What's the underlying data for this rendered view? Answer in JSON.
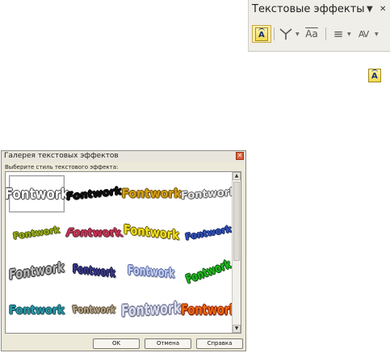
{
  "toolbar": {
    "title": "Текстовые эффекты",
    "menu_arrow": "▼",
    "close": "✕",
    "buttons": [
      "fontwork-gallery-icon",
      "fontwork-shape-icon",
      "same-letter-heights-icon",
      "alignment-icon",
      "character-spacing-icon"
    ],
    "same_heights_glyph": "Aa",
    "align_glyph": "≡",
    "spacing_glyph": "AV"
  },
  "standalone_icon": "fontwork-gallery-icon",
  "dialog": {
    "title": "Галерея текстовых эффектов",
    "close": "✕",
    "prompt": "Выберите стиль текстового эффекта:",
    "items": [
      {
        "text": "Fontwork",
        "color": "#ffffff",
        "stroke": "#444444"
      },
      {
        "text": "Fontwork",
        "color": "#111111",
        "stroke": "#000000"
      },
      {
        "text": "Fontwork",
        "color": "#d4a017",
        "stroke": "#6b4a00"
      },
      {
        "text": "Fontwork",
        "color": "#e8e8e8",
        "stroke": "#555555"
      },
      {
        "text": "Fontwork",
        "color": "#9cae1e",
        "stroke": "#4a5a00"
      },
      {
        "text": "Fontwork",
        "color": "#cc3355",
        "stroke": "#662233"
      },
      {
        "text": "Fontwork",
        "color": "#f2e21a",
        "stroke": "#6a5a00"
      },
      {
        "text": "Fontwork",
        "color": "#3355bb",
        "stroke": "#112266"
      },
      {
        "text": "Fontwork",
        "color": "#bbbbbb",
        "stroke": "#333333"
      },
      {
        "text": "Fontwork",
        "color": "#3a3a8a",
        "stroke": "#1a1a4a"
      },
      {
        "text": "Fontwork",
        "color": "#c8d2f0",
        "stroke": "#5a6aa8"
      },
      {
        "text": "Fontwork",
        "color": "#22bb22",
        "stroke": "#0a5a0a"
      },
      {
        "text": "Fontwork",
        "color": "#2a9aa8",
        "stroke": "#0e4a55"
      },
      {
        "text": "Fontwork",
        "color": "#b8a890",
        "stroke": "#5a4a30"
      },
      {
        "text": "Fontwork",
        "color": "#dde0ee",
        "stroke": "#6a6e90"
      },
      {
        "text": "Fontwork",
        "color": "#ee6a10",
        "stroke": "#8a1a00"
      }
    ],
    "buttons": {
      "ok": "OK",
      "cancel": "Отмена",
      "help": "Справка"
    }
  }
}
